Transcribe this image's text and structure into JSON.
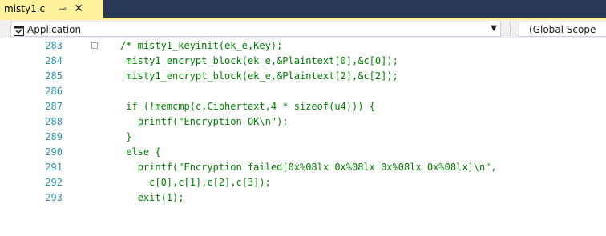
{
  "tab": {
    "filename": "misty1.c",
    "pin_glyph": "⊸",
    "close_glyph": "✕"
  },
  "navbar": {
    "scope_left": "Application",
    "scope_right": "(Global Scope"
  },
  "editor": {
    "lines": [
      {
        "number": "283",
        "tokens": [
          {
            "t": "/* misty1_keyinit(ek_e,Key);",
            "c": "cm"
          }
        ],
        "indent": ""
      },
      {
        "number": "284",
        "tokens": [
          {
            "t": "misty1_encrypt_block(ek_e,&Plaintext[0],&c[0]);",
            "c": "cm"
          }
        ],
        "indent": " "
      },
      {
        "number": "285",
        "tokens": [
          {
            "t": "misty1_encrypt_block(ek_e,&Plaintext[2],&c[2]);",
            "c": "cm"
          }
        ],
        "indent": " "
      },
      {
        "number": "286",
        "tokens": [],
        "indent": ""
      },
      {
        "number": "287",
        "tokens": [
          {
            "t": "if (!memcmp(c,Ciphertext,4 * sizeof(u4))) {",
            "c": "cm"
          }
        ],
        "indent": " "
      },
      {
        "number": "288",
        "tokens": [
          {
            "t": "printf(\"Encryption OK\\n\");",
            "c": "cm"
          }
        ],
        "indent": "   "
      },
      {
        "number": "289",
        "tokens": [
          {
            "t": "}",
            "c": "cm"
          }
        ],
        "indent": " "
      },
      {
        "number": "290",
        "tokens": [
          {
            "t": "else {",
            "c": "cm"
          }
        ],
        "indent": " "
      },
      {
        "number": "291",
        "tokens": [
          {
            "t": "printf(\"Encryption failed[0x%08lx 0x%08lx 0x%08lx 0x%08lx]\\n\",",
            "c": "cm"
          }
        ],
        "indent": "   "
      },
      {
        "number": "292",
        "tokens": [
          {
            "t": "c[0],c[1],c[2],c[3]);",
            "c": "cm"
          }
        ],
        "indent": "     "
      },
      {
        "number": "293",
        "tokens": [
          {
            "t": "exit(1);",
            "c": "cm"
          }
        ],
        "indent": "   "
      }
    ]
  },
  "colors": {
    "tab_active": "#fff29d",
    "tabstrip_bg": "#293955",
    "line_number": "#2b91af",
    "comment": "#008000"
  }
}
